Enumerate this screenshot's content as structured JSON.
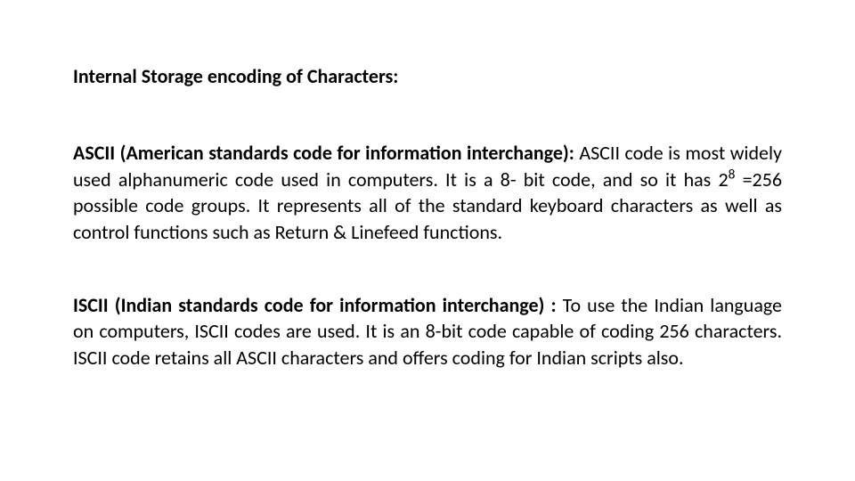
{
  "heading": "Internal Storage encoding of Characters:",
  "ascii": {
    "term": "ASCII (American standards code for information interchange):",
    "body_pre": " ASCII code is most widely used alphanumeric code used in computers. It is a 8- bit code, and so it has 2",
    "exp": "8",
    "body_post": " =256 possible code groups. It represents all of the standard keyboard characters as well as control functions such as Return & Linefeed functions."
  },
  "iscii": {
    "term": "ISCII (Indian standards code for information interchange) :",
    "body": " To use the Indian language on computers, ISCII codes are used. It is an 8-bit code capable of coding 256 characters. ISCII code retains all ASCII characters and offers coding for Indian scripts also."
  }
}
